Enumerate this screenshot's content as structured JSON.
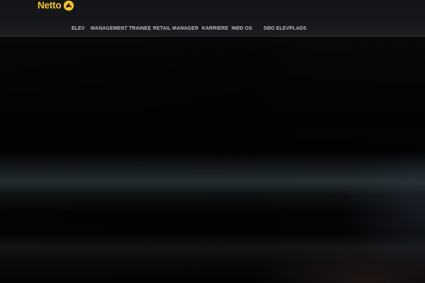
{
  "header": {
    "logo_text": "Netto",
    "logo_icon": "scottie-dog-icon",
    "brand_color": "#f6c81b"
  },
  "nav": {
    "items": [
      {
        "label": "ELEV"
      },
      {
        "label": "MANAGEMENT TRAINEE"
      },
      {
        "label": "RETAIL MANAGER"
      },
      {
        "label": "KARRIERE"
      },
      {
        "label": "MØD OS"
      },
      {
        "label": "SØG ELEVPLADS"
      }
    ],
    "text_color": "#b9bcc2"
  },
  "hero": {
    "background": "blurred-dark-image"
  }
}
